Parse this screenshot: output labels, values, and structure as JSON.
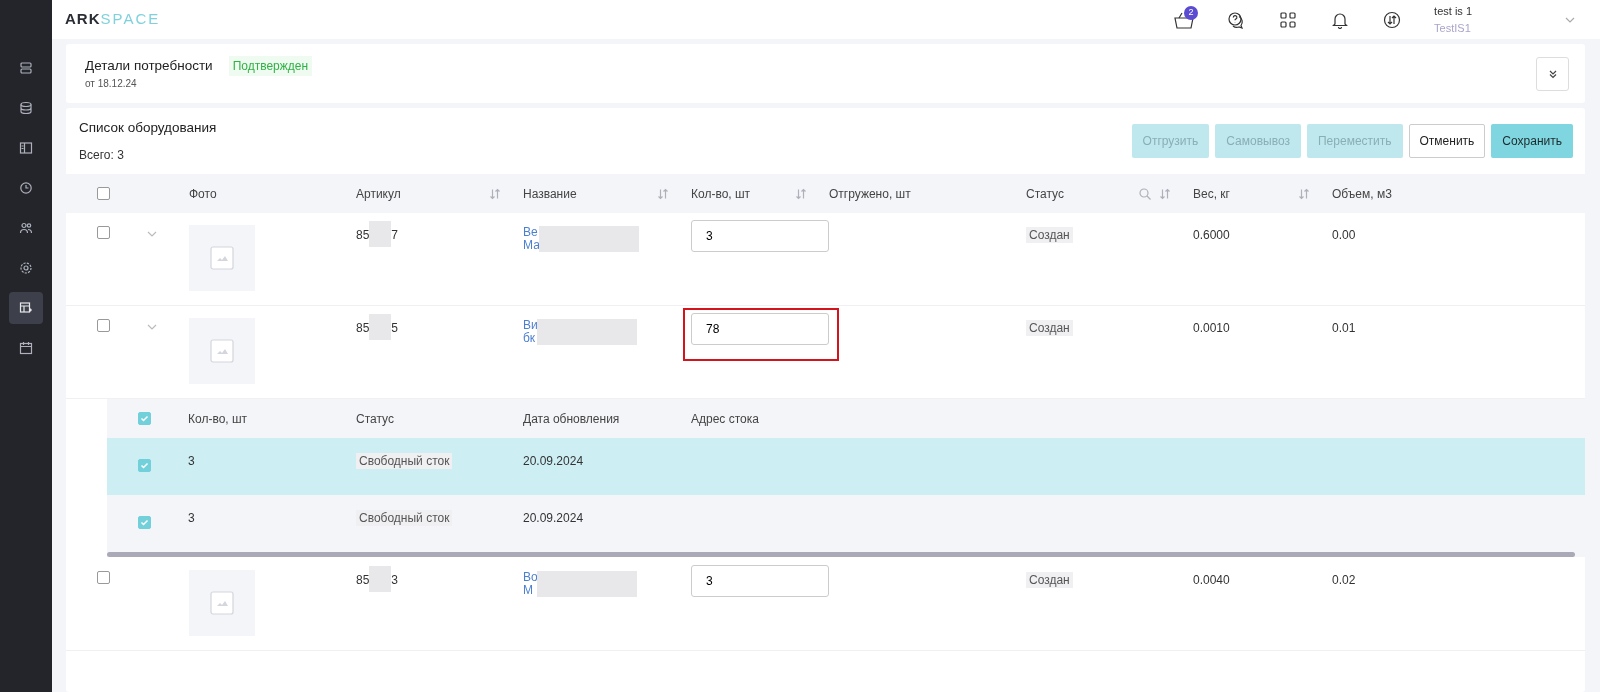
{
  "sidebar": {
    "items": [
      {
        "kind": "server",
        "selected": false
      },
      {
        "kind": "database",
        "selected": false
      },
      {
        "kind": "panel",
        "selected": false
      },
      {
        "kind": "clock",
        "selected": false
      },
      {
        "kind": "users",
        "selected": false
      },
      {
        "kind": "gear",
        "selected": false
      },
      {
        "kind": "table",
        "selected": true
      },
      {
        "kind": "calendar",
        "selected": false
      }
    ]
  },
  "header": {
    "logo_bold": "ARK",
    "logo_light": "SPACE",
    "cart_count": "2",
    "user_name": "test is 1",
    "user_login": "TestIS1"
  },
  "details": {
    "title": "Детали потребности",
    "status": "Подтвержден",
    "date": "от 18.12.24"
  },
  "equipment": {
    "title": "Список оборудования",
    "total": "Всего: 3",
    "buttons": [
      {
        "label": "Отгрузить",
        "kind": "action",
        "disabled": true
      },
      {
        "label": "Самовывоз",
        "kind": "action",
        "disabled": true
      },
      {
        "label": "Переместить",
        "kind": "action",
        "disabled": true
      },
      {
        "label": "Отменить",
        "kind": "outline",
        "disabled": false
      },
      {
        "label": "Сохранить",
        "kind": "primary",
        "disabled": false
      }
    ],
    "select_all": {
      "checked": false
    },
    "columns": [
      {
        "label": "Фото"
      },
      {
        "label": "Артикул",
        "tools": [
          {
            "kind": "sort"
          }
        ]
      },
      {
        "label": "Название",
        "tools": [
          {
            "kind": "sort"
          }
        ]
      },
      {
        "label": "Кол-во, шт",
        "tools": [
          {
            "kind": "sort"
          }
        ]
      },
      {
        "label": "Отгружено, шт"
      },
      {
        "label": "Статус",
        "tools": [
          {
            "kind": "search"
          },
          {
            "kind": "sort"
          }
        ]
      },
      {
        "label": "Вес, кг",
        "tools": [
          {
            "kind": "sort"
          }
        ]
      },
      {
        "label": "Объем, м3"
      }
    ],
    "rows": [
      {
        "checked": false,
        "expandable": true,
        "article_start": "85",
        "article_end": "7",
        "name_lines": [
          "Ве",
          "Ма"
        ],
        "quantity": "3",
        "highlighted": false,
        "status": "Создан",
        "weight": "0.6000",
        "volume": "0.00"
      },
      {
        "checked": false,
        "expandable": true,
        "article_start": "85",
        "article_end": "5",
        "name_lines": [
          "Ви",
          "бк"
        ],
        "quantity": "78",
        "highlighted": true,
        "status": "Создан",
        "weight": "0.0010",
        "volume": "0.01",
        "stock": {
          "checked": true,
          "columns": [
            "Кол-во, шт",
            "Статус",
            "Дата обновления",
            "Адрес стока"
          ],
          "rows": [
            {
              "checked": true,
              "selected": true,
              "quantity": "3",
              "status": "Свободный сток",
              "date": "20.09.2024"
            },
            {
              "checked": true,
              "selected": false,
              "quantity": "3",
              "status": "Свободный сток",
              "date": "20.09.2024"
            }
          ]
        }
      },
      {
        "checked": false,
        "expandable": false,
        "article_start": "85",
        "article_end": "3",
        "name_lines": [
          "Во",
          "М"
        ],
        "quantity": "3",
        "highlighted": false,
        "status": "Создан",
        "weight": "0.0040",
        "volume": "0.02"
      }
    ]
  }
}
